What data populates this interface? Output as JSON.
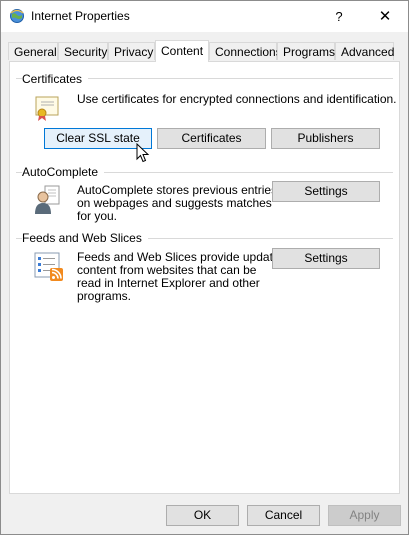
{
  "window": {
    "title": "Internet Properties",
    "help_glyph": "?",
    "close_glyph": "✕"
  },
  "tabs": [
    {
      "label": "General"
    },
    {
      "label": "Security"
    },
    {
      "label": "Privacy"
    },
    {
      "label": "Content",
      "active": true
    },
    {
      "label": "Connections"
    },
    {
      "label": "Programs"
    },
    {
      "label": "Advanced"
    }
  ],
  "certificates": {
    "heading": "Certificates",
    "description": "Use certificates for encrypted connections and identification.",
    "icon": "certificate-icon",
    "clear_ssl_label": "Clear SSL state",
    "certificates_label": "Certificates",
    "publishers_label": "Publishers"
  },
  "autocomplete": {
    "heading": "AutoComplete",
    "description_lines": [
      "AutoComplete stores previous entries",
      "on webpages and suggests matches",
      "for you."
    ],
    "icon": "autocomplete-user-icon",
    "settings_label": "Settings"
  },
  "feeds": {
    "heading": "Feeds and Web Slices",
    "description_lines": [
      "Feeds and Web Slices provide updated",
      "content from websites that can be",
      "read in Internet Explorer and other",
      "programs."
    ],
    "icon": "feeds-icon",
    "settings_label": "Settings"
  },
  "footer": {
    "ok_label": "OK",
    "cancel_label": "Cancel",
    "apply_label": "Apply"
  },
  "colors": {
    "focus_border": "#0078d7",
    "button_bg": "#e1e1e1"
  }
}
